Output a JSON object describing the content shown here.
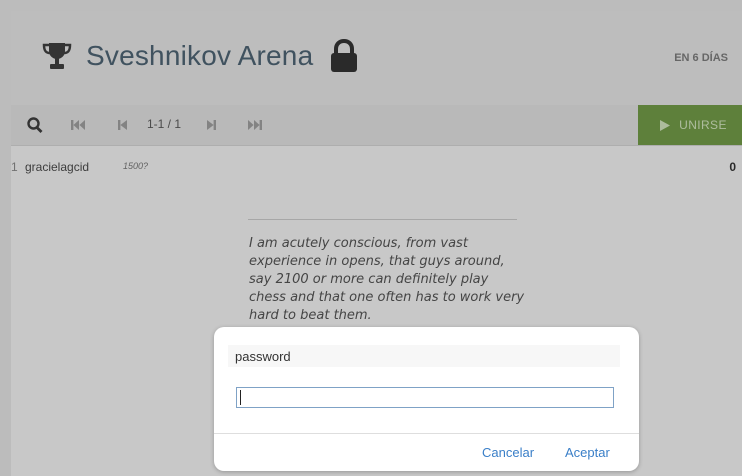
{
  "header": {
    "title": "Sveshnikov Arena",
    "trophy_icon": "trophy-icon",
    "lock_icon": "lock-icon",
    "countdown": "EN 6 DÍAS"
  },
  "toolbar": {
    "search_icon": "search-icon",
    "first_icon": "first-page-icon",
    "prev_icon": "previous-page-icon",
    "page_info": "1-1 / 1",
    "next_icon": "next-page-icon",
    "last_icon": "last-page-icon",
    "join_label": "UNIRSE",
    "join_color": "#729a48"
  },
  "standings": [
    {
      "rank": "1",
      "name": "gracielagcid",
      "rating": "1500?",
      "score": "0"
    }
  ],
  "quote": {
    "text": "I am acutely conscious, from vast experience in opens, that guys around, say 2100 or more can definitely play chess and that one often has to work very hard to beat them."
  },
  "dialog": {
    "label": "password",
    "input_value": "",
    "cancel_label": "Cancelar",
    "ok_label": "Aceptar",
    "accent_color": "#3a7fc8"
  }
}
